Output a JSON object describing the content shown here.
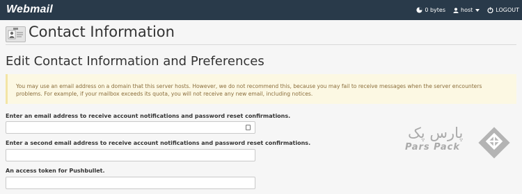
{
  "topbar": {
    "logo": "Webmail",
    "disk_usage": "0 bytes",
    "user": "host",
    "logout_label": "LOGOUT"
  },
  "header": {
    "title": "Contact Information"
  },
  "section": {
    "title": "Edit Contact Information and Preferences"
  },
  "notice": {
    "text": "You may use an email address on a domain that this server hosts. However, we do not recommend this, because you may fail to receive messages when the server encounters problems. For example, if your mailbox exceeds its quota, you will not receive any new email, including notices."
  },
  "fields": [
    {
      "label": "Enter an email address to receive account notifications and password reset confirmations.",
      "value": ""
    },
    {
      "label": "Enter a second email address to receive account notifications and password reset confirmations.",
      "value": ""
    },
    {
      "label": "An access token for Pushbullet.",
      "value": ""
    }
  ],
  "watermark": {
    "text_fa": "پارس پک",
    "text_en": "Pars Pack"
  },
  "colors": {
    "topbar_bg": "#293a4a",
    "notice_bg": "#fcf8e3",
    "notice_text": "#8a6d3b",
    "page_bg": "#f6f6f6"
  },
  "icons": [
    "pie-chart-icon",
    "user-icon",
    "caret-down-icon",
    "logout-icon",
    "contact-card-icon",
    "id-card-icon",
    "parspack-diamond-logo"
  ]
}
